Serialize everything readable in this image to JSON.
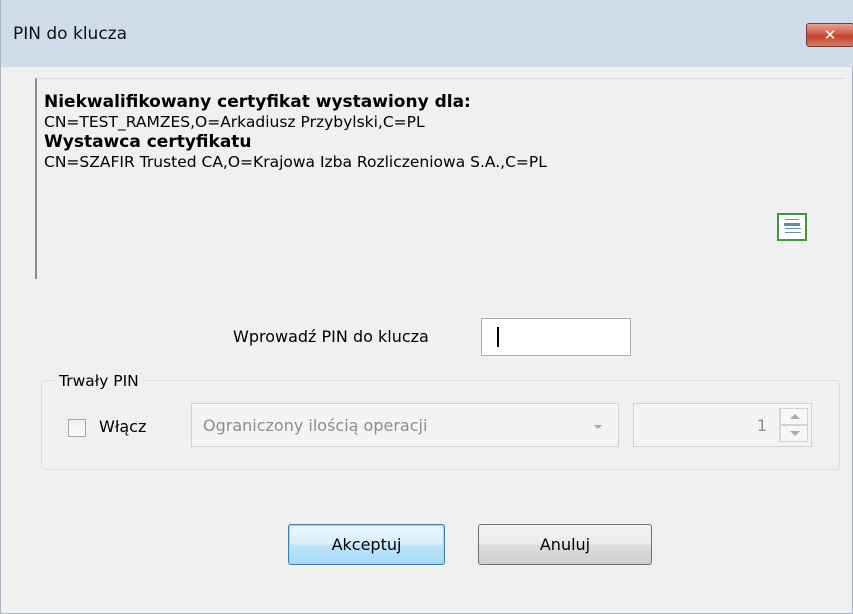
{
  "window": {
    "title": "PIN do klucza",
    "close_symbol": "✕"
  },
  "certificate": {
    "subject_heading": "Niekwalifikowany certyfikat wystawiony dla:",
    "subject_value": "CN=TEST_RAMZES,O=Arkadiusz Przybylski,C=PL",
    "issuer_heading": "Wystawca certyfikatu",
    "issuer_value": "CN=SZAFIR Trusted CA,O=Krajowa Izba Rozliczeniowa S.A.,C=PL",
    "icon": "certificate-icon"
  },
  "pin": {
    "label": "Wprowadź PIN do klucza",
    "value": ""
  },
  "permanent_pin": {
    "legend": "Trwały PIN",
    "enable_label": "Włącz",
    "enabled": false,
    "mode_selected": "Ograniczony ilością operacji",
    "count_value": "1"
  },
  "buttons": {
    "accept_label": "Akceptuj",
    "cancel_label": "Anuluj"
  },
  "colors": {
    "titlebar": "#cfdbe9",
    "close_button": "#c1432f",
    "dialog_background": "#f0f0f0",
    "accept_border": "#3c7fb1"
  }
}
